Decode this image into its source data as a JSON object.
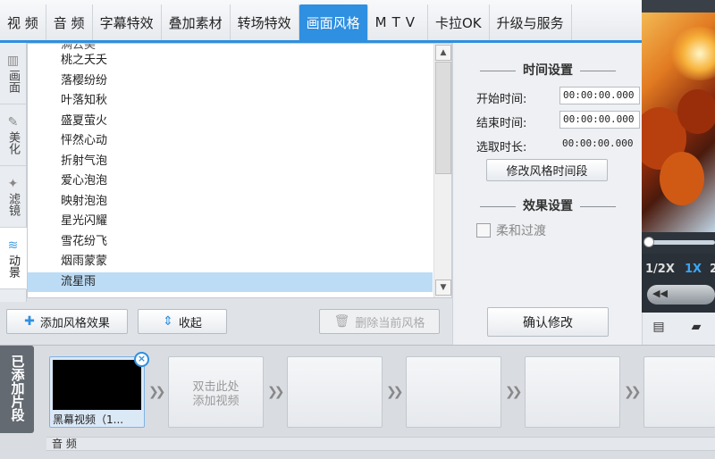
{
  "tabs": [
    {
      "label": "视 频",
      "active": false
    },
    {
      "label": "音 频",
      "active": false
    },
    {
      "label": "字幕特效",
      "active": false
    },
    {
      "label": "叠加素材",
      "active": false
    },
    {
      "label": "转场特效",
      "active": false
    },
    {
      "label": "画面风格",
      "active": true
    },
    {
      "label": "MTV",
      "active": false
    },
    {
      "label": "卡拉OK",
      "active": false
    },
    {
      "label": "升级与服务",
      "active": false
    }
  ],
  "side_tabs": [
    {
      "label": "画面",
      "icon": "film-icon"
    },
    {
      "label": "美化",
      "icon": "brush-icon"
    },
    {
      "label": "滤镜",
      "icon": "magic-wand-icon"
    },
    {
      "label": "动景",
      "icon": "waves-icon",
      "active": true
    }
  ],
  "effects": {
    "partial_item": "满云美",
    "items": [
      "桃之夭夭",
      "落樱纷纷",
      "叶落知秋",
      "盛夏萤火",
      "怦然心动",
      "折射气泡",
      "爱心泡泡",
      "映射泡泡",
      "星光闪耀",
      "雪花纷飞",
      "烟雨蒙蒙",
      "流星雨"
    ],
    "selected": "流星雨"
  },
  "toolbar": {
    "add_label": "添加风格效果",
    "collapse_label": "收起",
    "delete_label": "删除当前风格"
  },
  "settings": {
    "time_title": "时间设置",
    "start_label": "开始时间:",
    "start_value": "00:00:00.000",
    "end_label": "结束时间:",
    "end_value": "00:00:00.000",
    "duration_label": "选取时长:",
    "duration_value": "00:00:00.000",
    "modify_button": "修改风格时间段",
    "effect_title": "效果设置",
    "soft_transition_label": "柔和过渡",
    "confirm_button": "确认修改"
  },
  "preview": {
    "speeds": [
      "1/2X",
      "1X",
      "2"
    ],
    "active_speed": "1X",
    "rewind_icon": "◀◀"
  },
  "timeline": {
    "added_label": "已添加片段",
    "first_clip_caption": "黑幕视频（1...",
    "empty_hint_line1": "双击此处",
    "empty_hint_line2": "添加视频",
    "audio_label": "音 频"
  },
  "colors": {
    "accent": "#2f8fe0",
    "selected_row": "#bcdcf5"
  }
}
